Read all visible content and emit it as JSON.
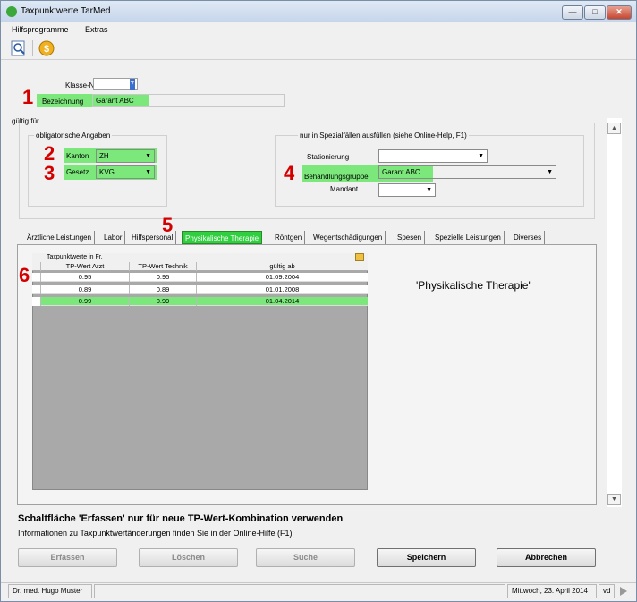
{
  "window": {
    "title": "Taxpunktwerte TarMed",
    "btn_min": "—",
    "btn_max": "□",
    "btn_close": "✕"
  },
  "menu": {
    "items": [
      "Hilfsprogramme",
      "Extras"
    ]
  },
  "toolbar": {
    "icons": [
      "search-icon",
      "coin-icon"
    ]
  },
  "form": {
    "klasse_label": "Klasse-Nr.",
    "klasse_value": "7",
    "bezeichnung_label": "Bezeichnung",
    "bezeichnung_value": "Garant ABC",
    "gueltig_label": "gültig für",
    "obligatorisch_title": "obligatorische Angaben",
    "kanton_label": "Kanton",
    "kanton_value": "ZH",
    "gesetz_label": "Gesetz",
    "gesetz_value": "KVG",
    "spezial_title": "nur in Spezialfällen ausfüllen (siehe Online-Help, F1)",
    "stationierung_label": "Stationierung",
    "stationierung_value": "",
    "behandlung_label": "Behandlungsgruppe",
    "behandlung_value": "Garant ABC",
    "mandant_label": "Mandant",
    "mandant_value": ""
  },
  "markers": [
    "1",
    "2",
    "3",
    "4",
    "5",
    "6"
  ],
  "tabs": [
    "Ärztliche Leistungen",
    "Labor",
    "Hilfspersonal",
    "Physikalische Therapie",
    "Röntgen",
    "Wegentschädigungen",
    "Spesen",
    "Spezielle Leistungen",
    "Diverses"
  ],
  "active_tab": "Physikalische Therapie",
  "panel": {
    "heading": "'Physikalische Therapie'",
    "grid_caption": "Taxpunktwerte in Fr.",
    "columns": [
      "TP-Wert Arzt",
      "TP-Wert Technik",
      "gültig ab"
    ],
    "rows": [
      [
        "0.95",
        "0.95",
        "01.09.2004"
      ],
      [
        "0.89",
        "0.89",
        "01.01.2008"
      ],
      [
        "0.99",
        "0.99",
        "01.04.2014"
      ]
    ],
    "selected_row": 2
  },
  "notes": {
    "bold": "Schaltfläche 'Erfassen' nur für neue TP-Wert-Kombination verwenden",
    "info": "Informationen zu Taxpunktwertänderungen finden Sie in der Online-Hilfe (F1)"
  },
  "buttons": {
    "erfassen": "Erfassen",
    "loeschen": "Löschen",
    "suche": "Suche",
    "speichern": "Speichern",
    "abbrechen": "Abbrechen"
  },
  "status": {
    "user": "Dr. med. Hugo Muster",
    "date": "Mittwoch, 23. April 2014",
    "code": "vd"
  },
  "colors": {
    "highlight": "#7ce87c",
    "active_tab": "#2fcf3f",
    "marker": "#d40000"
  }
}
